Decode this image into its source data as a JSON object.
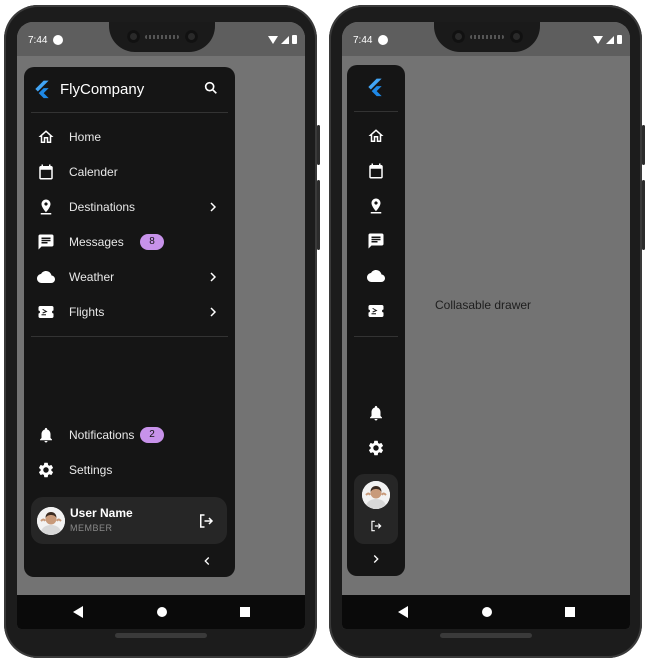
{
  "status": {
    "time": "7:44"
  },
  "app": {
    "brand_name": "FlyCompany"
  },
  "menu": {
    "items": [
      {
        "label": "Home",
        "icon": "home-icon"
      },
      {
        "label": "Calender",
        "icon": "calendar-icon"
      },
      {
        "label": "Destinations",
        "icon": "location-pin-icon",
        "has_submenu": true
      },
      {
        "label": "Messages",
        "icon": "message-icon",
        "badge": "8"
      },
      {
        "label": "Weather",
        "icon": "cloud-icon",
        "has_submenu": true
      },
      {
        "label": "Flights",
        "icon": "flight-ticket-icon",
        "has_submenu": true
      }
    ],
    "footer_items": [
      {
        "label": "Notifications",
        "icon": "bell-icon",
        "badge": "2"
      },
      {
        "label": "Settings",
        "icon": "gear-icon"
      }
    ]
  },
  "user": {
    "name": "User Name",
    "role": "MEMBER"
  },
  "content": {
    "center_text": "Collasable drawer"
  },
  "colors": {
    "drawer_bg": "#151515",
    "screen_bg": "#737373",
    "badge_bg": "#c792ea",
    "brand_accent": "#42a5f5"
  }
}
